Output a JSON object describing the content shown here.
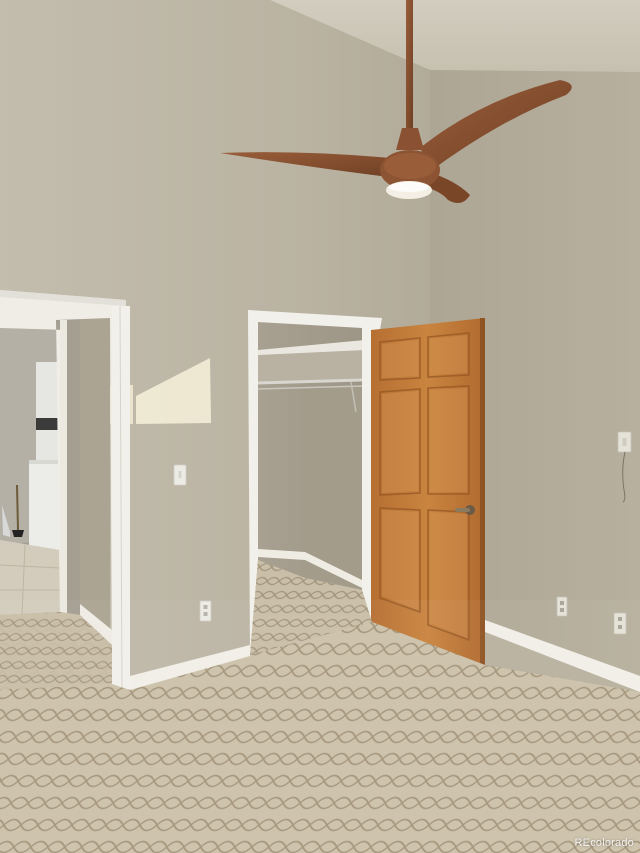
{
  "watermark": {
    "text": "REcolorado"
  },
  "palette": {
    "wall_left": "#bdb6a5",
    "wall_right": "#b3ab98",
    "ceiling": "#cdc8b8",
    "trim": "#f1efe8",
    "door_wood": "#c27c3c",
    "door_wood_dark": "#a3652c",
    "fan_wood": "#8a5233",
    "carpet_base": "#cfc4ae",
    "carpet_pattern": "#a6977c"
  },
  "icons": {
    "ceiling_fan": "ceiling-fan-icon",
    "door_knob": "door-knob-icon",
    "light_switch": "light-switch-icon",
    "outlet": "outlet-icon"
  }
}
